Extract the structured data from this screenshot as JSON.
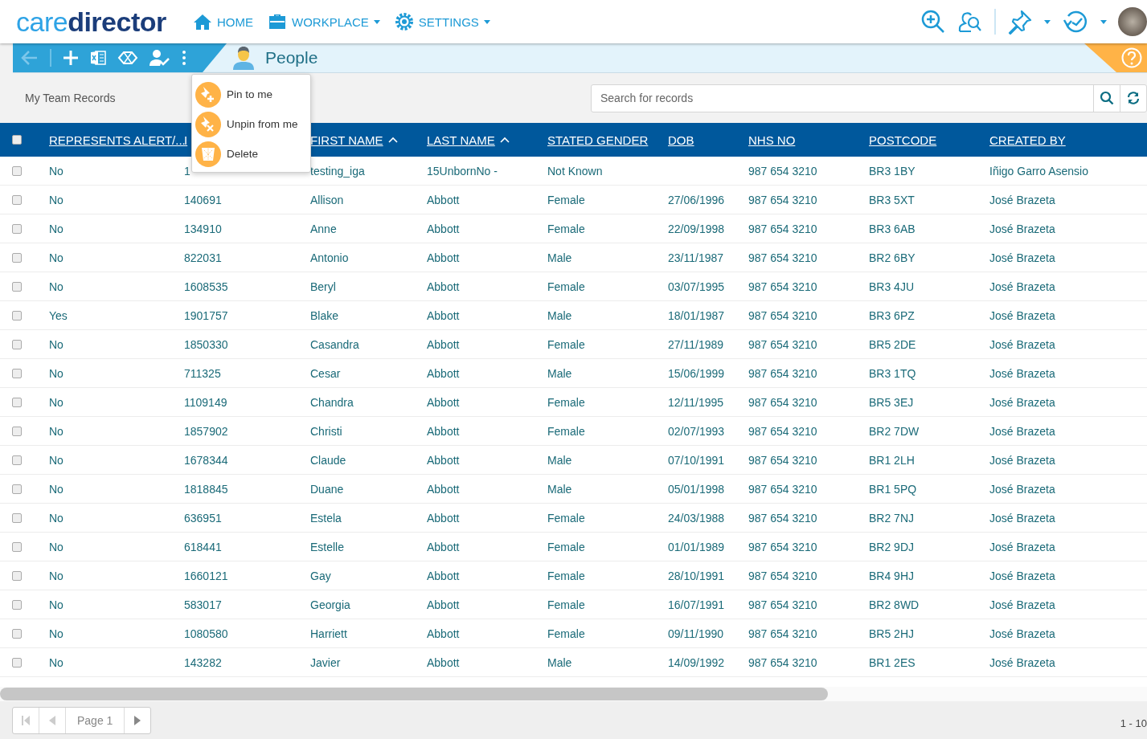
{
  "header": {
    "logo": {
      "part_1": "care",
      "part_2": "director"
    },
    "nav": [
      {
        "label": "HOME",
        "kind": "home",
        "has_dropdown": false
      },
      {
        "label": "WORKPLACE",
        "kind": "briefcase",
        "has_dropdown": true
      },
      {
        "label": "SETTINGS",
        "kind": "gear",
        "has_dropdown": true
      }
    ]
  },
  "toolbar": {
    "title": "People"
  },
  "context_menu": [
    {
      "label": "Pin to me",
      "kind": "pin"
    },
    {
      "label": "Unpin from me",
      "kind": "unpin"
    },
    {
      "label": "Delete",
      "kind": "delete"
    }
  ],
  "view": {
    "name": "My Team Records"
  },
  "search": {
    "placeholder": "Search for records"
  },
  "table": {
    "select_all": {
      "checked": false
    },
    "columns": [
      {
        "label": "REPRESENTS ALERT/...",
        "sorted": false
      },
      {
        "label": "I",
        "sorted": false
      },
      {
        "label": "FIRST NAME",
        "sorted": true
      },
      {
        "label": "LAST NAME",
        "sorted": true
      },
      {
        "label": "STATED GENDER",
        "sorted": false
      },
      {
        "label": "DOB",
        "sorted": false
      },
      {
        "label": "NHS NO",
        "sorted": false
      },
      {
        "label": "POSTCODE",
        "sorted": false
      },
      {
        "label": "CREATED BY",
        "sorted": false
      }
    ],
    "rows": [
      {
        "checked": false,
        "cells": [
          "No",
          "1",
          "testing_iga",
          "15UnbornNo -",
          "Not Known",
          "",
          "987 654 3210",
          "BR3 1BY",
          "Iñigo Garro Asensio"
        ]
      },
      {
        "checked": false,
        "cells": [
          "No",
          "140691",
          "Allison",
          "Abbott",
          "Female",
          "27/06/1996",
          "987 654 3210",
          "BR3 5XT",
          "José Brazeta"
        ]
      },
      {
        "checked": false,
        "cells": [
          "No",
          "134910",
          "Anne",
          "Abbott",
          "Female",
          "22/09/1998",
          "987 654 3210",
          "BR3 6AB",
          "José Brazeta"
        ]
      },
      {
        "checked": false,
        "cells": [
          "No",
          "822031",
          "Antonio",
          "Abbott",
          "Male",
          "23/11/1987",
          "987 654 3210",
          "BR2 6BY",
          "José Brazeta"
        ]
      },
      {
        "checked": false,
        "cells": [
          "No",
          "1608535",
          "Beryl",
          "Abbott",
          "Female",
          "03/07/1995",
          "987 654 3210",
          "BR3 4JU",
          "José Brazeta"
        ]
      },
      {
        "checked": false,
        "cells": [
          "Yes",
          "1901757",
          "Blake",
          "Abbott",
          "Male",
          "18/01/1987",
          "987 654 3210",
          "BR3 6PZ",
          "José Brazeta"
        ]
      },
      {
        "checked": false,
        "cells": [
          "No",
          "1850330",
          "Casandra",
          "Abbott",
          "Female",
          "27/11/1989",
          "987 654 3210",
          "BR5 2DE",
          "José Brazeta"
        ]
      },
      {
        "checked": false,
        "cells": [
          "No",
          "711325",
          "Cesar",
          "Abbott",
          "Male",
          "15/06/1999",
          "987 654 3210",
          "BR3 1TQ",
          "José Brazeta"
        ]
      },
      {
        "checked": false,
        "cells": [
          "No",
          "1109149",
          "Chandra",
          "Abbott",
          "Female",
          "12/11/1995",
          "987 654 3210",
          "BR5 3EJ",
          "José Brazeta"
        ]
      },
      {
        "checked": false,
        "cells": [
          "No",
          "1857902",
          "Christi",
          "Abbott",
          "Female",
          "02/07/1993",
          "987 654 3210",
          "BR2 7DW",
          "José Brazeta"
        ]
      },
      {
        "checked": false,
        "cells": [
          "No",
          "1678344",
          "Claude",
          "Abbott",
          "Male",
          "07/10/1991",
          "987 654 3210",
          "BR1 2LH",
          "José Brazeta"
        ]
      },
      {
        "checked": false,
        "cells": [
          "No",
          "1818845",
          "Duane",
          "Abbott",
          "Male",
          "05/01/1998",
          "987 654 3210",
          "BR1 5PQ",
          "José Brazeta"
        ]
      },
      {
        "checked": false,
        "cells": [
          "No",
          "636951",
          "Estela",
          "Abbott",
          "Female",
          "24/03/1988",
          "987 654 3210",
          "BR2 7NJ",
          "José Brazeta"
        ]
      },
      {
        "checked": false,
        "cells": [
          "No",
          "618441",
          "Estelle",
          "Abbott",
          "Female",
          "01/01/1989",
          "987 654 3210",
          "BR2 9DJ",
          "José Brazeta"
        ]
      },
      {
        "checked": false,
        "cells": [
          "No",
          "1660121",
          "Gay",
          "Abbott",
          "Female",
          "28/10/1991",
          "987 654 3210",
          "BR4 9HJ",
          "José Brazeta"
        ]
      },
      {
        "checked": false,
        "cells": [
          "No",
          "583017",
          "Georgia",
          "Abbott",
          "Female",
          "16/07/1991",
          "987 654 3210",
          "BR2 8WD",
          "José Brazeta"
        ]
      },
      {
        "checked": false,
        "cells": [
          "No",
          "1080580",
          "Harriett",
          "Abbott",
          "Female",
          "09/11/1990",
          "987 654 3210",
          "BR5 2HJ",
          "José Brazeta"
        ]
      },
      {
        "checked": false,
        "cells": [
          "No",
          "143282",
          "Javier",
          "Abbott",
          "Male",
          "14/09/1992",
          "987 654 3210",
          "BR1 2ES",
          "José Brazeta"
        ]
      }
    ]
  },
  "pager": {
    "page": "Page 1",
    "range": "1 - 10"
  }
}
